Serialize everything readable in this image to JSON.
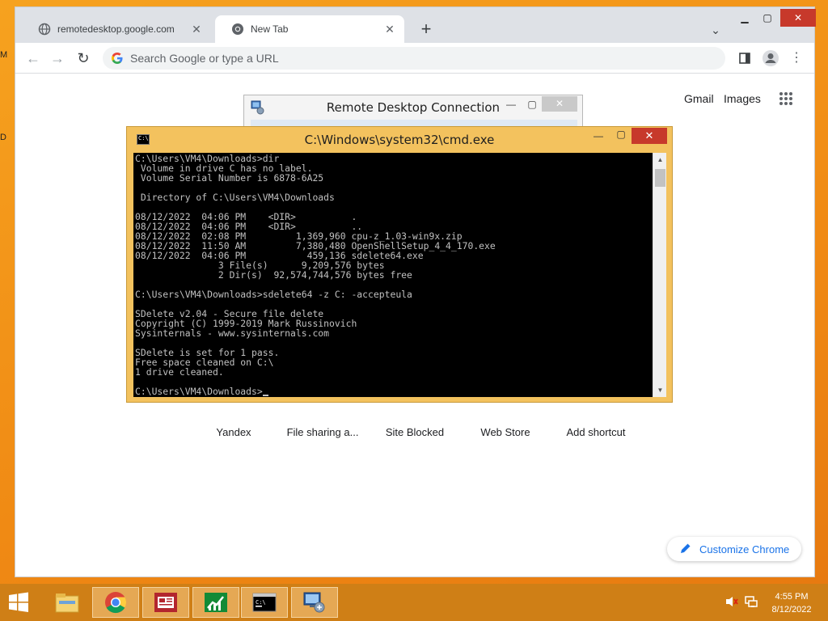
{
  "desktop": {
    "edge_labels": [
      "M",
      "D"
    ]
  },
  "chrome": {
    "tabs": [
      {
        "title": "remotedesktop.google.com",
        "icon": "globe-icon",
        "active": false
      },
      {
        "title": "New Tab",
        "icon": "chrome-icon",
        "active": true
      }
    ],
    "new_tab_label": "+",
    "omnibox": {
      "placeholder": "Search Google or type a URL"
    },
    "ntp": {
      "header_links": [
        "Gmail",
        "Images"
      ],
      "shortcuts": [
        "Yandex",
        "File sharing a...",
        "Site Blocked",
        "Web Store",
        "Add shortcut"
      ],
      "customize_label": "Customize Chrome"
    }
  },
  "rdc_window": {
    "title": "Remote Desktop Connection"
  },
  "cmd_window": {
    "title": "C:\\Windows\\system32\\cmd.exe",
    "console_lines": [
      "C:\\Users\\VM4\\Downloads>dir",
      " Volume in drive C has no label.",
      " Volume Serial Number is 6878-6A25",
      "",
      " Directory of C:\\Users\\VM4\\Downloads",
      "",
      "08/12/2022  04:06 PM    <DIR>          .",
      "08/12/2022  04:06 PM    <DIR>          ..",
      "08/12/2022  02:08 PM         1,369,960 cpu-z_1.03-win9x.zip",
      "08/12/2022  11:50 AM         7,380,480 OpenShellSetup_4_4_170.exe",
      "08/12/2022  04:06 PM           459,136 sdelete64.exe",
      "               3 File(s)      9,209,576 bytes",
      "               2 Dir(s)  92,574,744,576 bytes free",
      "",
      "C:\\Users\\VM4\\Downloads>sdelete64 -z C: -accepteula",
      "",
      "SDelete v2.04 - Secure file delete",
      "Copyright (C) 1999-2019 Mark Russinovich",
      "Sysinternals - www.sysinternals.com",
      "",
      "SDelete is set for 1 pass.",
      "Free space cleaned on C:\\",
      "1 drive cleaned.",
      "",
      "C:\\Users\\VM4\\Downloads>"
    ]
  },
  "taskbar": {
    "apps": [
      "file-explorer-icon",
      "chrome-icon",
      "news-app-icon",
      "finance-app-icon",
      "cmd-icon",
      "remote-desktop-icon"
    ],
    "clock": {
      "time": "4:55 PM",
      "date": "8/12/2022"
    }
  },
  "colors": {
    "desktop": "#f29a1c",
    "taskbar": "#cf7f16",
    "cmd_frame": "#f3c25e",
    "close_red": "#c7392b",
    "link_blue": "#1a73e8"
  }
}
